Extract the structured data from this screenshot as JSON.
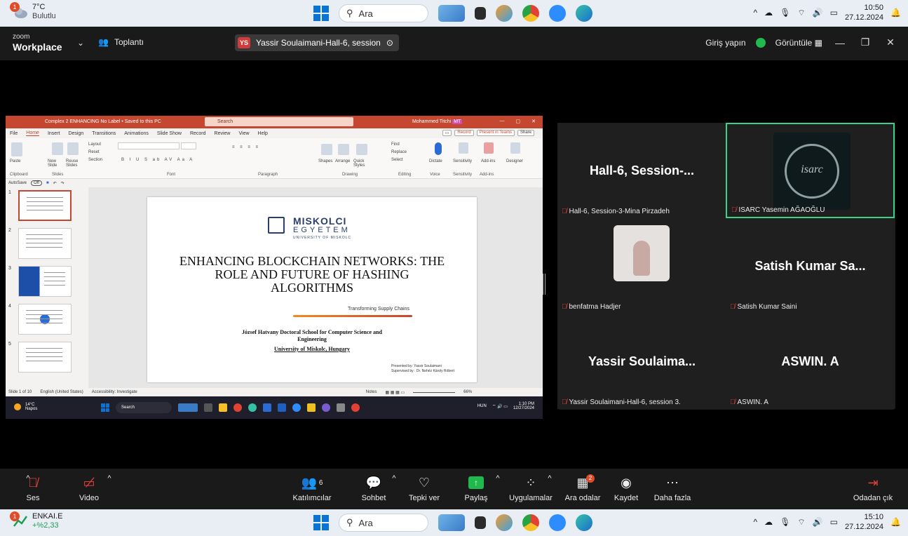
{
  "top_taskbar": {
    "weather_temp": "7°C",
    "weather_desc": "Bulutlu",
    "weather_badge": "1",
    "search_label": "Ara",
    "time": "10:50",
    "date": "27.12.2024"
  },
  "bottom_taskbar": {
    "stock_name": "ENKAI.E",
    "stock_change": "+%2,33",
    "stock_badge": "1",
    "search_label": "Ara",
    "time": "15:10",
    "date": "27.12.2024"
  },
  "zoom": {
    "brand_small": "zoom",
    "brand_big": "Workplace",
    "meeting_label": "Toplantı",
    "active_tab_initials": "YS",
    "active_tab_label": "Yassir Soulaimani-Hall-6, session",
    "signin_label": "Giriş yapın",
    "view_label": "Görüntüle"
  },
  "powerpoint": {
    "doc_title": "Complex 2 ENHANCING  No Label • Saved to this PC",
    "search_placeholder": "Search",
    "user_name": "Mohammed Titchi",
    "user_initials": "MT",
    "menu": [
      "File",
      "Home",
      "Insert",
      "Design",
      "Transitions",
      "Animations",
      "Slide Show",
      "Record",
      "Review",
      "View",
      "Help"
    ],
    "record_btn": "Record",
    "teams_btn": "Present in Teams",
    "share_btn": "Share",
    "ribbon_groups": [
      "Clipboard",
      "Slides",
      "Font",
      "Paragraph",
      "Drawing",
      "Editing",
      "Voice",
      "Sensitivity",
      "Add-ins"
    ],
    "ribbon_labels": {
      "paste": "Paste",
      "new_slide": "New Slide",
      "reuse_slides": "Reuse Slides",
      "layout": "Layout",
      "reset": "Reset",
      "section": "Section",
      "shapes": "Shapes",
      "arrange": "Arrange",
      "quick_styles": "Quick Styles",
      "find": "Find",
      "replace": "Replace",
      "select": "Select",
      "dictate": "Dictate",
      "sensitivity": "Sensitivity",
      "addins": "Add-ins",
      "designer": "Designer"
    },
    "autosave": "AutoSave",
    "autosave_state": "Off",
    "thumb_numbers": [
      "1",
      "2",
      "3",
      "4",
      "5"
    ],
    "slide": {
      "uni_line1": "MISKOLCI",
      "uni_line2": "EGYETEM",
      "uni_line3": "UNIVERSITY OF MISKOLC",
      "title": "ENHANCING BLOCKCHAIN NETWORKS: THE ROLE AND FUTURE OF HASHING ALGORITHMS",
      "subtitle": "Transforming Supply Chains",
      "school": "József Hatvany Doctoral School for Computer Science and Engineering",
      "university": "University of Miskolc, Hungary",
      "presented_by": "Presented by: Yassir Soulaimani",
      "supervised_by": "Supervised by : Dr. Nehéz Károly Róbert"
    },
    "status": {
      "slide_count": "Slide 1 of 10",
      "language": "English (United States)",
      "accessibility": "Accessibility: Investigate",
      "notes": "Notes",
      "zoom": "66%"
    },
    "inner_taskbar": {
      "temp": "14°C",
      "desc": "Napos",
      "search": "Search",
      "lang": "HUN",
      "time": "1:10 PM",
      "date": "12/27/2024"
    }
  },
  "participants": [
    {
      "big": "Hall-6,  Session-...",
      "name": "Hall-6, Session-3-Mina Pirzadeh"
    },
    {
      "big": "",
      "name": "ISARC Yasemin AĞAOĞLU",
      "logo_text": "isarc"
    },
    {
      "big": "",
      "name": "benfatma Hadjer"
    },
    {
      "big": "Satish  Kumar  Sa...",
      "name": "Satish Kumar Saini"
    },
    {
      "big": "Yassir  Soulaima...",
      "name": "Yassir Soulaimani-Hall-6, session 3."
    },
    {
      "big": "ASWIN. A",
      "name": "ASWIN. A"
    }
  ],
  "toolbar": {
    "audio": "Ses",
    "video": "Video",
    "participants": "Katılımcılar",
    "participants_count": "6",
    "chat": "Sohbet",
    "react": "Tepki ver",
    "share": "Paylaş",
    "apps": "Uygulamalar",
    "breakout": "Ara odalar",
    "breakout_badge": "2",
    "record": "Kaydet",
    "more": "Daha fazla",
    "leave": "Odadan çık"
  },
  "colors": {
    "pp_accent": "#c5472f",
    "zoom_bg": "#1a1a1a",
    "active_speaker": "#3ad28a",
    "muted": "#e0413c",
    "share_green": "#1fb94d"
  }
}
